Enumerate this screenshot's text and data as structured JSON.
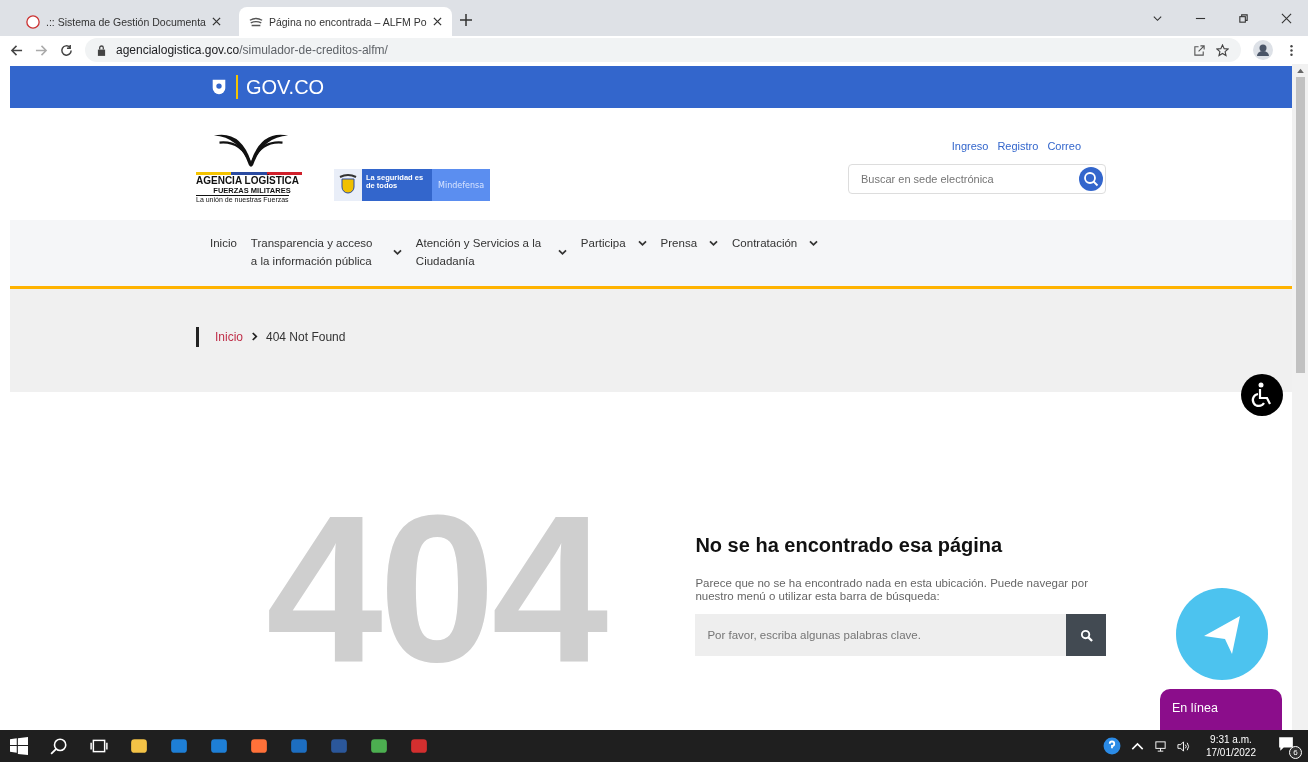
{
  "browser": {
    "tabs": [
      {
        "title": ".:: Sistema de Gestión Documenta",
        "selected": false
      },
      {
        "title": "Página no encontrada – ALFM Po",
        "selected": true
      }
    ],
    "url_host": "agencialogistica.gov.co",
    "url_path": "/simulador-de-creditos-alfm/"
  },
  "gov_bar": {
    "logo_text": "GOV.CO"
  },
  "header": {
    "agency_name": "AGENCIA LOGÍSTICA",
    "agency_sub": "FUERZAS MILITARES",
    "agency_motto": "La unión de nuestras Fuerzas",
    "slogan": "La seguridad es de todos",
    "ministry": "Mindefensa",
    "links": [
      "Ingreso",
      "Registro",
      "Correo"
    ],
    "search": {
      "placeholder": "Buscar en sede electrónica"
    }
  },
  "nav": [
    {
      "label": "Inicio",
      "has_menu": false
    },
    {
      "label": "Transparencia y acceso a la información pública",
      "has_menu": true
    },
    {
      "label": "Atención y Servicios a la Ciudadanía",
      "has_menu": true
    },
    {
      "label": "Participa",
      "has_menu": true
    },
    {
      "label": "Prensa",
      "has_menu": true
    },
    {
      "label": "Contratación",
      "has_menu": true
    }
  ],
  "breadcrumb": [
    "Inicio",
    "404 Not Found"
  ],
  "error": {
    "code": "404",
    "heading": "No se ha encontrado esa página",
    "message": "Parece que no se ha encontrado nada en esta ubicación. Puede navegar por nuestro menú o utilizar esta barra de búsqueda:",
    "search": {
      "placeholder": "Por favor, escriba algunas palabras clave."
    }
  },
  "chat": {
    "status": "En línea"
  },
  "taskbar": {
    "time": "9:31 a.m.",
    "date": "17/01/2022",
    "notifications": "6"
  }
}
